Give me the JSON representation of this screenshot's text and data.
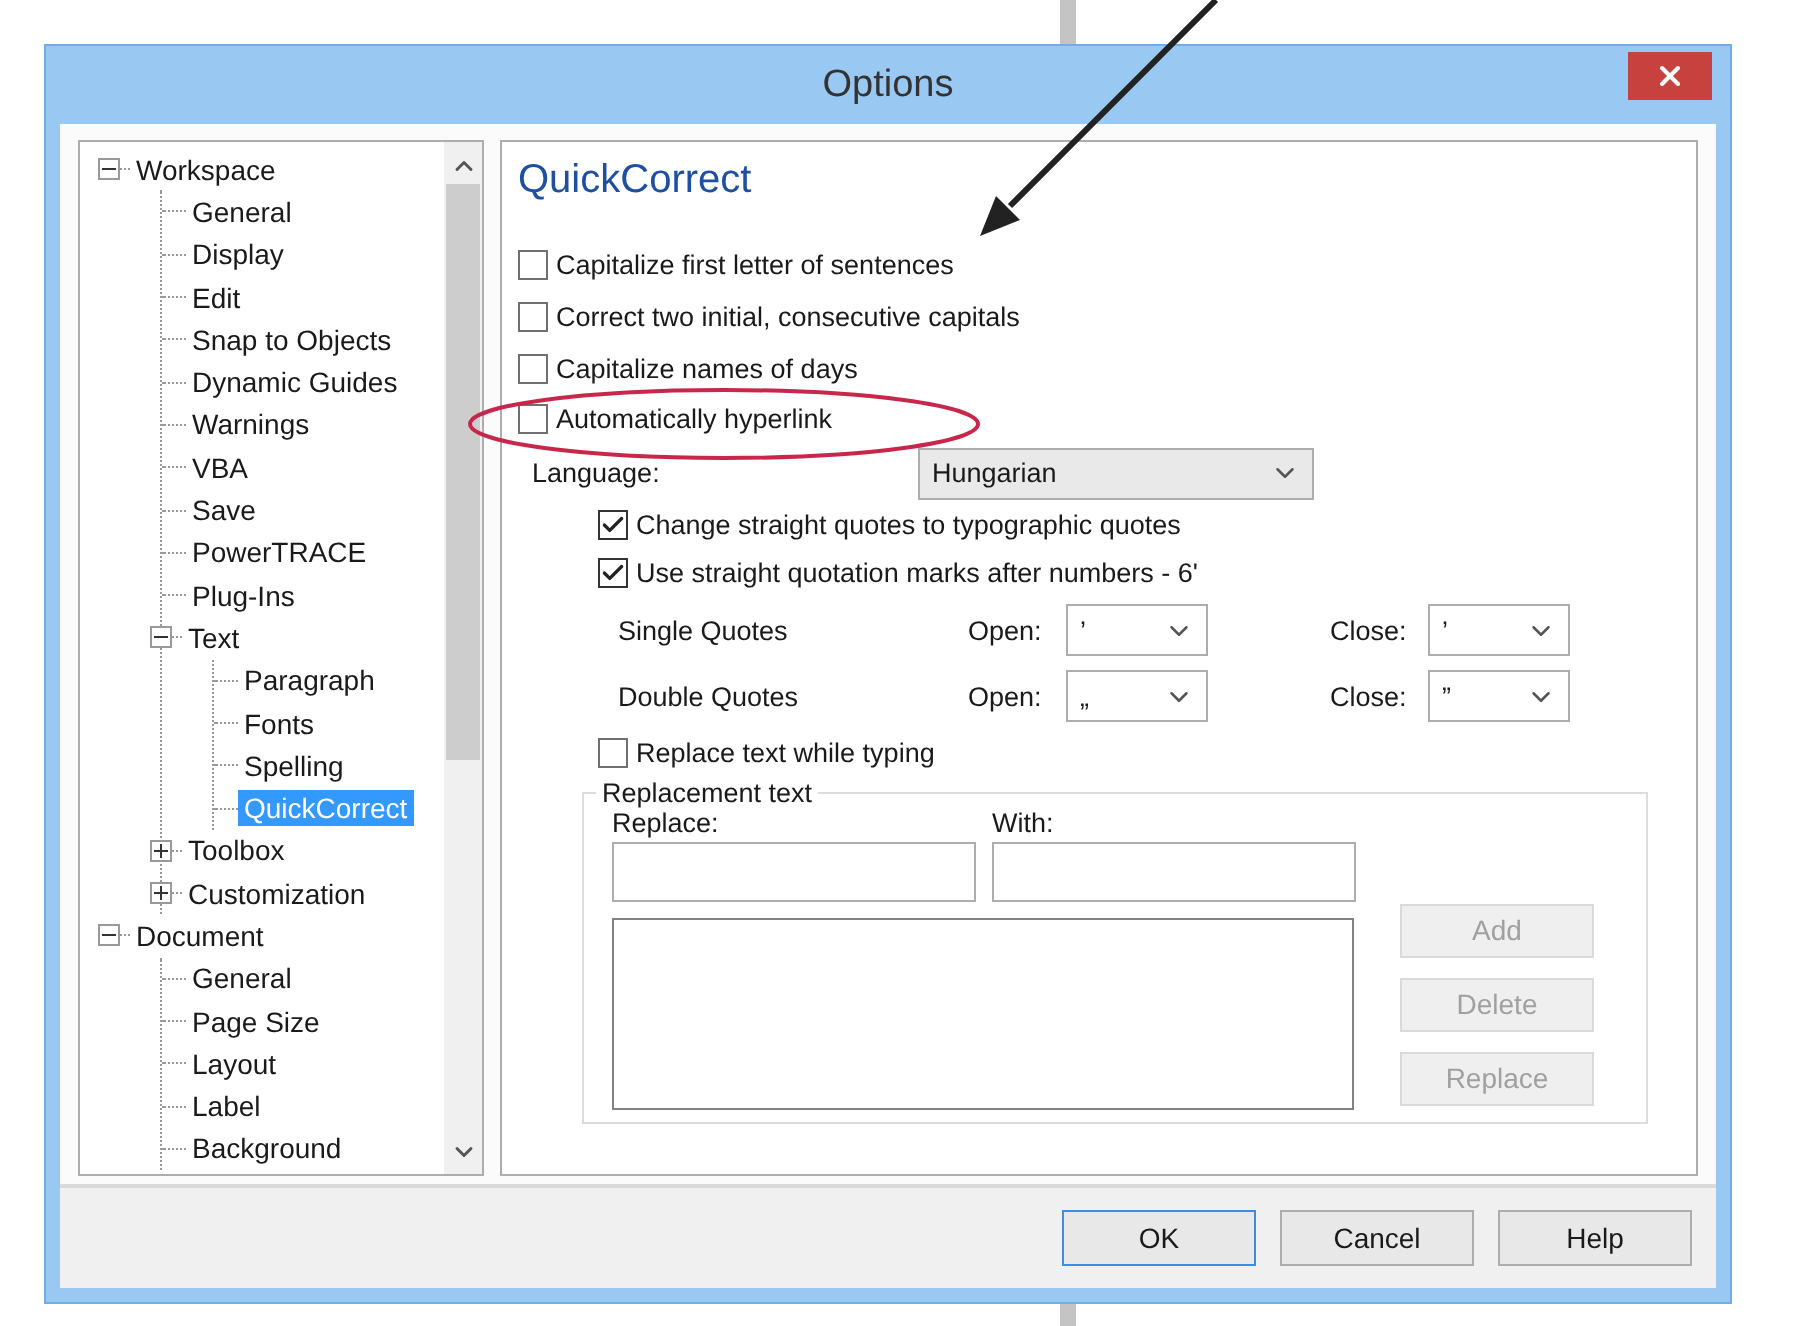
{
  "window": {
    "title": "Options"
  },
  "tree": [
    {
      "label": "Workspace",
      "expanded": true,
      "selected": false,
      "children": [
        {
          "label": "General",
          "selected": false
        },
        {
          "label": "Display",
          "selected": false
        },
        {
          "label": "Edit",
          "selected": false
        },
        {
          "label": "Snap to Objects",
          "selected": false
        },
        {
          "label": "Dynamic Guides",
          "selected": false
        },
        {
          "label": "Warnings",
          "selected": false
        },
        {
          "label": "VBA",
          "selected": false
        },
        {
          "label": "Save",
          "selected": false
        },
        {
          "label": "PowerTRACE",
          "selected": false
        },
        {
          "label": "Plug-Ins",
          "selected": false
        },
        {
          "label": "Text",
          "expanded": true,
          "selected": false,
          "children": [
            {
              "label": "Paragraph",
              "selected": false
            },
            {
              "label": "Fonts",
              "selected": false
            },
            {
              "label": "Spelling",
              "selected": false
            },
            {
              "label": "QuickCorrect",
              "selected": true
            }
          ]
        },
        {
          "label": "Toolbox",
          "expanded": false,
          "selected": false
        },
        {
          "label": "Customization",
          "expanded": false,
          "selected": false
        }
      ]
    },
    {
      "label": "Document",
      "expanded": true,
      "selected": false,
      "children": [
        {
          "label": "General",
          "selected": false
        },
        {
          "label": "Page Size",
          "selected": false
        },
        {
          "label": "Layout",
          "selected": false
        },
        {
          "label": "Label",
          "selected": false
        },
        {
          "label": "Background",
          "selected": false
        }
      ]
    }
  ],
  "page": {
    "title": "QuickCorrect",
    "options": [
      {
        "label": "Capitalize first letter of sentences",
        "checked": false
      },
      {
        "label": "Correct two initial, consecutive capitals",
        "checked": false
      },
      {
        "label": "Capitalize names of days",
        "checked": false
      },
      {
        "label": "Automatically hyperlink",
        "checked": false
      }
    ],
    "language": {
      "label": "Language:",
      "value": "Hungarian"
    },
    "quote_options": [
      {
        "label": "Change straight quotes to typographic quotes",
        "checked": true
      },
      {
        "label": "Use straight quotation marks after numbers - 6'",
        "checked": true
      }
    ],
    "quotes": [
      {
        "label": "Single Quotes",
        "open_label": "Open:",
        "open_value": "’",
        "close_label": "Close:",
        "close_value": "’"
      },
      {
        "label": "Double Quotes",
        "open_label": "Open:",
        "open_value": "„",
        "close_label": "Close:",
        "close_value": "”"
      }
    ],
    "replace_option": {
      "label": "Replace text while typing",
      "checked": false
    },
    "replacement": {
      "legend": "Replacement text",
      "replace_label": "Replace:",
      "with_label": "With:",
      "buttons": [
        {
          "label": "Add",
          "disabled": true
        },
        {
          "label": "Delete",
          "disabled": true
        },
        {
          "label": "Replace",
          "disabled": true
        }
      ]
    }
  },
  "buttons": [
    {
      "label": "OK",
      "default": true
    },
    {
      "label": "Cancel",
      "default": false
    },
    {
      "label": "Help",
      "default": false
    }
  ]
}
